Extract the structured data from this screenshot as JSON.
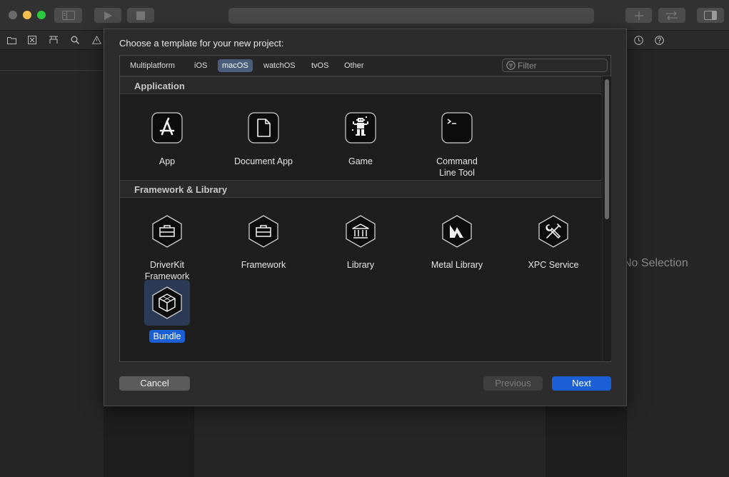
{
  "colors": {
    "accent": "#1a5fd6",
    "sheet_background": "#2c2c2c",
    "panel_background": "#1e1e1e",
    "selected_tab": "#4a5d7a"
  },
  "inspector": {
    "placeholder_text": "No Selection"
  },
  "sheet": {
    "title": "Choose a template for your new project:",
    "tabs": [
      {
        "label": "Multiplatform",
        "selected": false
      },
      {
        "label": "iOS",
        "selected": false
      },
      {
        "label": "macOS",
        "selected": true
      },
      {
        "label": "watchOS",
        "selected": false
      },
      {
        "label": "tvOS",
        "selected": false
      },
      {
        "label": "Other",
        "selected": false
      }
    ],
    "filter": {
      "placeholder": "Filter",
      "value": ""
    },
    "sections": [
      {
        "title": "Application",
        "items": [
          {
            "label": "App",
            "icon": "app-store-a-icon"
          },
          {
            "label": "Document App",
            "icon": "document-icon"
          },
          {
            "label": "Game",
            "icon": "game-sprite-icon"
          },
          {
            "label": "Command Line Tool",
            "label_lines": [
              "Command",
              "Line Tool"
            ],
            "icon": "terminal-icon"
          }
        ]
      },
      {
        "title": "Framework & Library",
        "items": [
          {
            "label": "DriverKit Framework",
            "label_lines": [
              "DriverKit",
              "Framework"
            ],
            "icon": "toolbox-hexagon-icon"
          },
          {
            "label": "Framework",
            "icon": "toolbox-hexagon-icon"
          },
          {
            "label": "Library",
            "icon": "library-building-hexagon-icon"
          },
          {
            "label": "Metal Library",
            "icon": "metal-hexagon-icon"
          },
          {
            "label": "XPC Service",
            "icon": "wrench-screwdriver-hexagon-icon"
          },
          {
            "label": "Bundle",
            "icon": "cube-hexagon-icon",
            "selected": true
          }
        ]
      }
    ],
    "buttons": {
      "cancel": "Cancel",
      "previous": "Previous",
      "next": "Next"
    }
  }
}
